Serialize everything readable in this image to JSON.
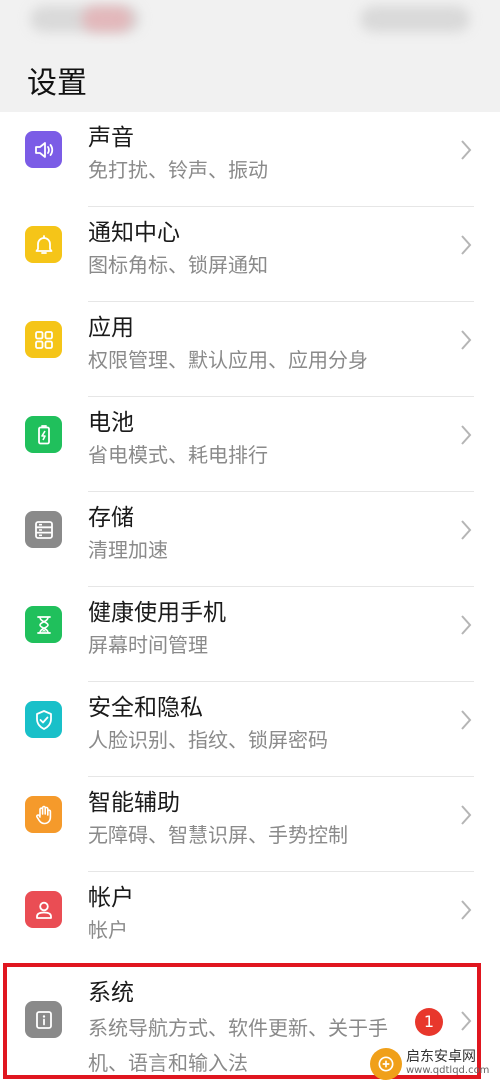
{
  "header": {
    "title": "设置"
  },
  "items": [
    {
      "label": "声音",
      "sub": "免打扰、铃声、振动",
      "icon": "speaker-icon",
      "color": "#7b5ce6"
    },
    {
      "label": "通知中心",
      "sub": "图标角标、锁屏通知",
      "icon": "bell-icon",
      "color": "#f5c518"
    },
    {
      "label": "应用",
      "sub": "权限管理、默认应用、应用分身",
      "icon": "apps-grid-icon",
      "color": "#f5c518"
    },
    {
      "label": "电池",
      "sub": "省电模式、耗电排行",
      "icon": "battery-icon",
      "color": "#20c05c"
    },
    {
      "label": "存储",
      "sub": "清理加速",
      "icon": "storage-icon",
      "color": "#8a8a8a"
    },
    {
      "label": "健康使用手机",
      "sub": "屏幕时间管理",
      "icon": "hourglass-icon",
      "color": "#20c05c"
    },
    {
      "label": "安全和隐私",
      "sub": "人脸识别、指纹、锁屏密码",
      "icon": "shield-check-icon",
      "color": "#19c0c9"
    },
    {
      "label": "智能辅助",
      "sub": "无障碍、智慧识屏、手势控制",
      "icon": "hand-icon",
      "color": "#f59a2b"
    },
    {
      "label": "帐户",
      "sub": "帐户",
      "icon": "person-icon",
      "color": "#ea4d54"
    }
  ],
  "system": {
    "label": "系统",
    "sub": "系统导航方式、软件更新、关于手机、语言和输入法",
    "icon": "info-icon",
    "color": "#8a8a8a",
    "badge": "1"
  },
  "watermark": {
    "line1": "启东安卓网",
    "line2": "www.qdtlqd.com"
  }
}
